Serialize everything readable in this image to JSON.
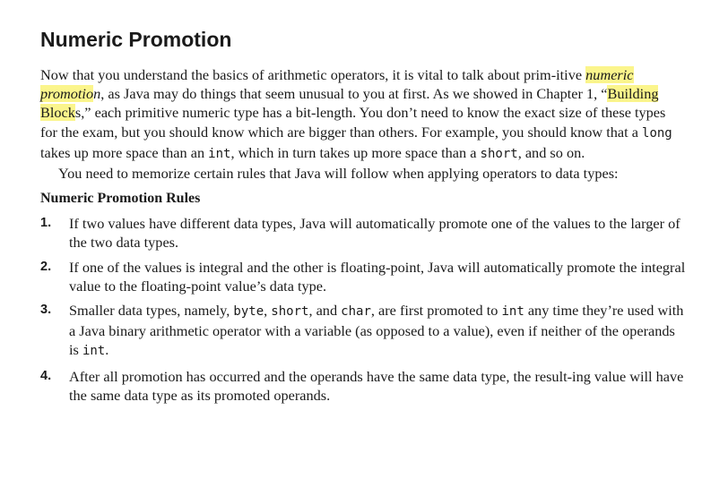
{
  "heading": "Numeric Promotion",
  "para1": {
    "t1": "Now that you understand the basics of arithmetic operators, it is vital to talk about prim-itive ",
    "hl_term_a": "numeric promotio",
    "term_b": "n",
    "t2": ", as Java may do things that seem unusual to you at first. As we showed in Chapter 1, “",
    "hl_ref": "Building Block",
    "t3": "s,” each primitive numeric type has a bit-length. You don’t need to know the exact size of these types for the exam, but you should know which are bigger than others. For example, you should know that a ",
    "c1": "long",
    "t4": " takes up more space than an ",
    "c2": "int",
    "t5": ", which in turn takes up more space than a ",
    "c3": "short",
    "t6": ", and so on."
  },
  "para2": "You need to memorize certain rules that Java will follow when applying operators to data types:",
  "rules_title": "Numeric Promotion Rules",
  "rules": [
    {
      "num": "1.",
      "text": "If two values have different data types, Java will automatically promote one of the values to the larger of the two data types."
    },
    {
      "num": "2.",
      "text": "If one of the values is integral and the other is floating-point, Java will automatically promote the integral value to the floating-point value’s data type."
    },
    {
      "num": "3.",
      "t1": "Smaller data types, namely, ",
      "c1": "byte",
      "t2": ", ",
      "c2": "short",
      "t3": ", and ",
      "c3": "char",
      "t4": ", are first promoted to ",
      "c4": "int",
      "t5": " any time they’re used with a Java binary arithmetic operator with a variable (as opposed to a value), even if neither of the operands is ",
      "c5": "int",
      "t6": "."
    },
    {
      "num": "4.",
      "text": "After all promotion has occurred and the operands have the same data type, the result-ing value will have the same data type as its promoted operands."
    }
  ]
}
